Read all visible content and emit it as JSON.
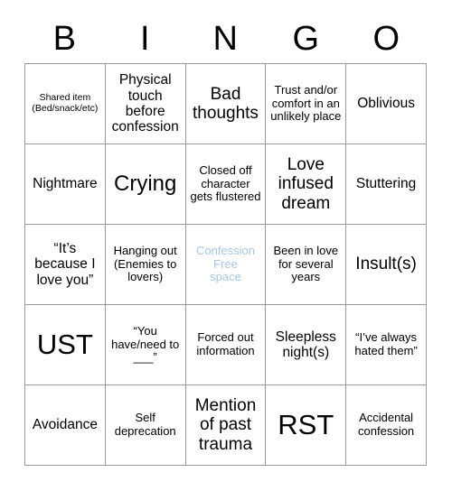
{
  "card": {
    "title_letters": [
      "B",
      "I",
      "N",
      "G",
      "O"
    ],
    "columns": 5,
    "rows": 5,
    "free_space_color": "#a3c6e8",
    "border_color": "#9a9a9a",
    "background_color": "#ffffff",
    "text_color": "#000000",
    "cells": [
      {
        "text": "Shared item\n(Bed/snack/etc)",
        "size": "xs",
        "free": false
      },
      {
        "text": "Physical touch before confession",
        "size": "m",
        "free": false
      },
      {
        "text": "Bad thoughts",
        "size": "l",
        "free": false
      },
      {
        "text": "Trust and/or comfort in an unlikely place",
        "size": "s",
        "free": false
      },
      {
        "text": "Oblivious",
        "size": "m",
        "free": false
      },
      {
        "text": "Nightmare",
        "size": "m",
        "free": false
      },
      {
        "text": "Crying",
        "size": "xl",
        "free": false
      },
      {
        "text": "Closed off character gets flustered",
        "size": "s",
        "free": false
      },
      {
        "text": "Love infused dream",
        "size": "l",
        "free": false
      },
      {
        "text": "Stuttering",
        "size": "m",
        "free": false
      },
      {
        "text": "“It’s because I love you”",
        "size": "m",
        "free": false
      },
      {
        "text": "Hanging out (Enemies to lovers)",
        "size": "s",
        "free": false
      },
      {
        "text": "Confession\nFree\nspace",
        "size": "s",
        "free": true
      },
      {
        "text": "Been in love for several years",
        "size": "s",
        "free": false
      },
      {
        "text": "Insult(s)",
        "size": "l",
        "free": false
      },
      {
        "text": "UST",
        "size": "xxl",
        "free": false
      },
      {
        "text": "“You have/need to ___”",
        "size": "s",
        "free": false
      },
      {
        "text": "Forced out information",
        "size": "s",
        "free": false
      },
      {
        "text": "Sleepless night(s)",
        "size": "m",
        "free": false
      },
      {
        "text": "“I’ve always hated them”",
        "size": "s",
        "free": false
      },
      {
        "text": "Avoidance",
        "size": "m",
        "free": false
      },
      {
        "text": "Self deprecation",
        "size": "s",
        "free": false
      },
      {
        "text": "Mention of past trauma",
        "size": "l",
        "free": false
      },
      {
        "text": "RST",
        "size": "xxl",
        "free": false
      },
      {
        "text": "Accidental confession",
        "size": "s",
        "free": false
      }
    ]
  }
}
